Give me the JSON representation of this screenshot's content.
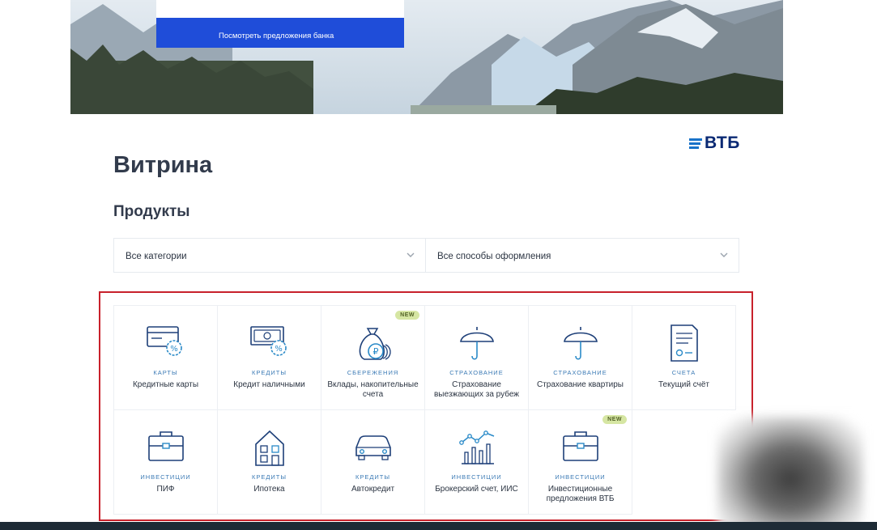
{
  "hero": {
    "button_label": "Посмотреть предложения банка"
  },
  "logo": {
    "text": "ВТБ"
  },
  "page": {
    "title": "Витрина",
    "section_title": "Продукты"
  },
  "filters": {
    "category": {
      "value": "Все категории"
    },
    "method": {
      "value": "Все способы оформления"
    }
  },
  "colors": {
    "accent": "#1f4dd9",
    "category_text": "#3b7ab5",
    "highlight_frame": "#c8212b",
    "badge_bg": "#d6e6a3"
  },
  "products": [
    {
      "category": "КАРТЫ",
      "name": "Кредитные карты",
      "icon": "credit-card-icon",
      "badge": ""
    },
    {
      "category": "КРЕДИТЫ",
      "name": "Кредит наличными",
      "icon": "cash-percent-icon",
      "badge": ""
    },
    {
      "category": "СБЕРЕЖЕНИЯ",
      "name": "Вклады, накопительные счета",
      "icon": "money-bag-icon",
      "badge": "NEW"
    },
    {
      "category": "СТРАХОВАНИЕ",
      "name": "Страхование выезжающих за рубеж",
      "icon": "umbrella-icon",
      "badge": ""
    },
    {
      "category": "СТРАХОВАНИЕ",
      "name": "Страхование квартиры",
      "icon": "umbrella-icon",
      "badge": ""
    },
    {
      "category": "СЧЕТА",
      "name": "Текущий счёт",
      "icon": "document-icon",
      "badge": ""
    },
    {
      "category": "ИНВЕСТИЦИИ",
      "name": "ПИФ",
      "icon": "briefcase-icon",
      "badge": ""
    },
    {
      "category": "КРЕДИТЫ",
      "name": "Ипотека",
      "icon": "house-icon",
      "badge": ""
    },
    {
      "category": "КРЕДИТЫ",
      "name": "Автокредит",
      "icon": "car-icon",
      "badge": ""
    },
    {
      "category": "ИНВЕСТИЦИИ",
      "name": "Брокерский счет, ИИС",
      "icon": "chart-icon",
      "badge": ""
    },
    {
      "category": "ИНВЕСТИЦИИ",
      "name": "Инвестиционные предложения ВТБ",
      "icon": "briefcase-icon",
      "badge": "NEW"
    }
  ]
}
